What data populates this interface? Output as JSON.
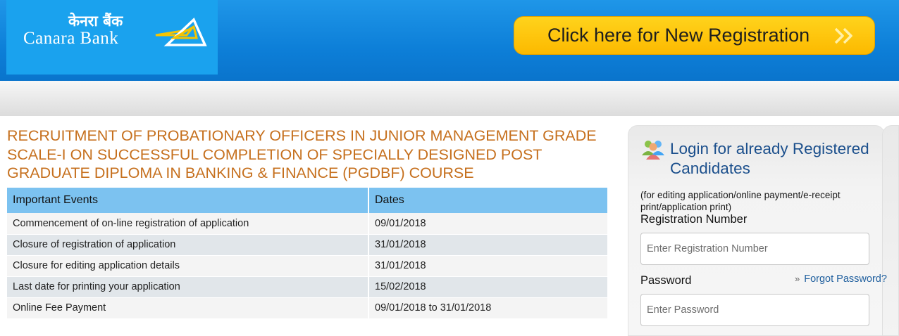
{
  "header": {
    "logo_hindi": "केनरा बैंक",
    "logo_english": "Canara Bank",
    "register_button_label": "Click here for New Registration"
  },
  "title": "RECRUITMENT OF PROBATIONARY OFFICERS IN JUNIOR MANAGEMENT GRADE SCALE-I ON SUCCESSFUL COMPLETION OF SPECIALLY DESIGNED POST GRADUATE DIPLOMA IN BANKING & FINANCE (PGDBF) COURSE",
  "events_table": {
    "headers": [
      "Important Events",
      "Dates"
    ],
    "rows": [
      [
        "Commencement of on-line registration of application",
        "09/01/2018"
      ],
      [
        "Closure of registration of application",
        "31/01/2018"
      ],
      [
        "Closure for editing application details",
        "31/01/2018"
      ],
      [
        "Last date for printing your application",
        "15/02/2018"
      ],
      [
        "Online Fee Payment",
        "09/01/2018 to 31/01/2018"
      ]
    ]
  },
  "login": {
    "title": "Login for already Registered Candidates",
    "note": "(for editing application/online payment/e-receipt print/application print)",
    "registration_label": "Registration Number",
    "registration_placeholder": "Enter Registration Number",
    "password_label": "Password",
    "password_placeholder": "Enter Password",
    "forgot_password": "Forgot Password?"
  },
  "colors": {
    "header_blue": "#0d7fd8",
    "logo_blue": "#1aa2ee",
    "button_yellow": "#fcb900",
    "title_orange": "#c6701e",
    "table_header_blue": "#7cc2f0",
    "login_title_blue": "#1b4f8c"
  }
}
